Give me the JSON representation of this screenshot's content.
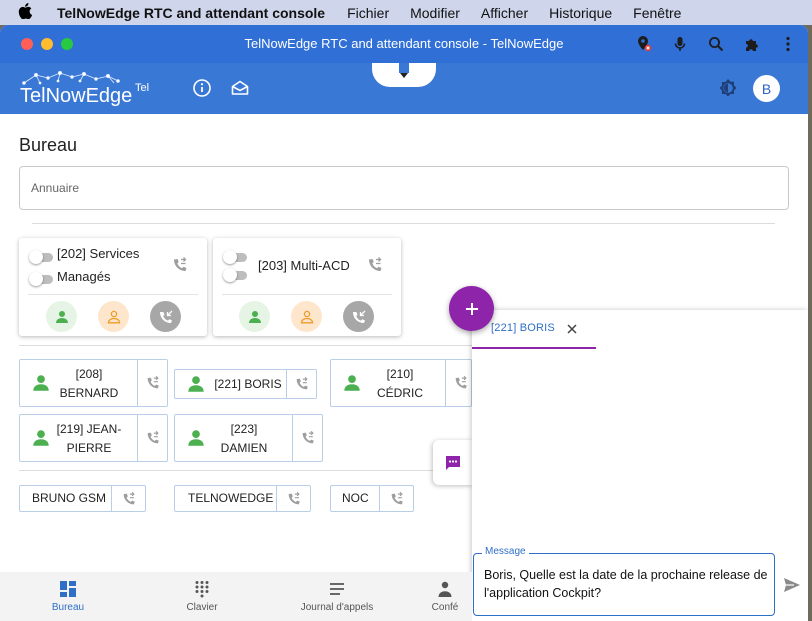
{
  "menubar": {
    "app_name": "TelNowEdge RTC and attendant console",
    "items": [
      "Fichier",
      "Modifier",
      "Afficher",
      "Historique",
      "Fenêtre"
    ]
  },
  "window": {
    "title": "TelNowEdge RTC and attendant console - TelNowEdge"
  },
  "header": {
    "logo_text": "TelNowEdge",
    "logo_sup": "Tel",
    "avatar_letter": "B"
  },
  "page": {
    "title": "Bureau",
    "search_placeholder": "Annuaire"
  },
  "groups": [
    {
      "line1": "[202] Services",
      "line2": "Managés"
    },
    {
      "line1": "[203] Multi-ACD"
    }
  ],
  "extensions": [
    {
      "line1": "[208]",
      "line2": "BERNARD"
    },
    {
      "line1": "[221] BORIS"
    },
    {
      "line1": "[210]",
      "line2": "CÉDRIC"
    },
    {
      "line1": "[219] JEAN-",
      "line2": "PIERRE"
    },
    {
      "line1": "[223]",
      "line2": "DAMIEN"
    }
  ],
  "external": [
    "BRUNO GSM",
    "TELNOWEDGE",
    "NOC"
  ],
  "chat": {
    "tab_label": "[221] BORIS",
    "message_label": "Message",
    "message_text": "Boris, Quelle est la date de la prochaine release de l'application Cockpit?"
  },
  "bottom_nav": [
    {
      "label": "Bureau",
      "active": true
    },
    {
      "label": "Clavier"
    },
    {
      "label": "Journal d'appels"
    },
    {
      "label": "Confé"
    }
  ],
  "colors": {
    "header_blue": "#3a78d6",
    "accent_purple": "#8e24aa",
    "presence_green": "#4caf50",
    "link_blue": "#2f6fc6"
  }
}
